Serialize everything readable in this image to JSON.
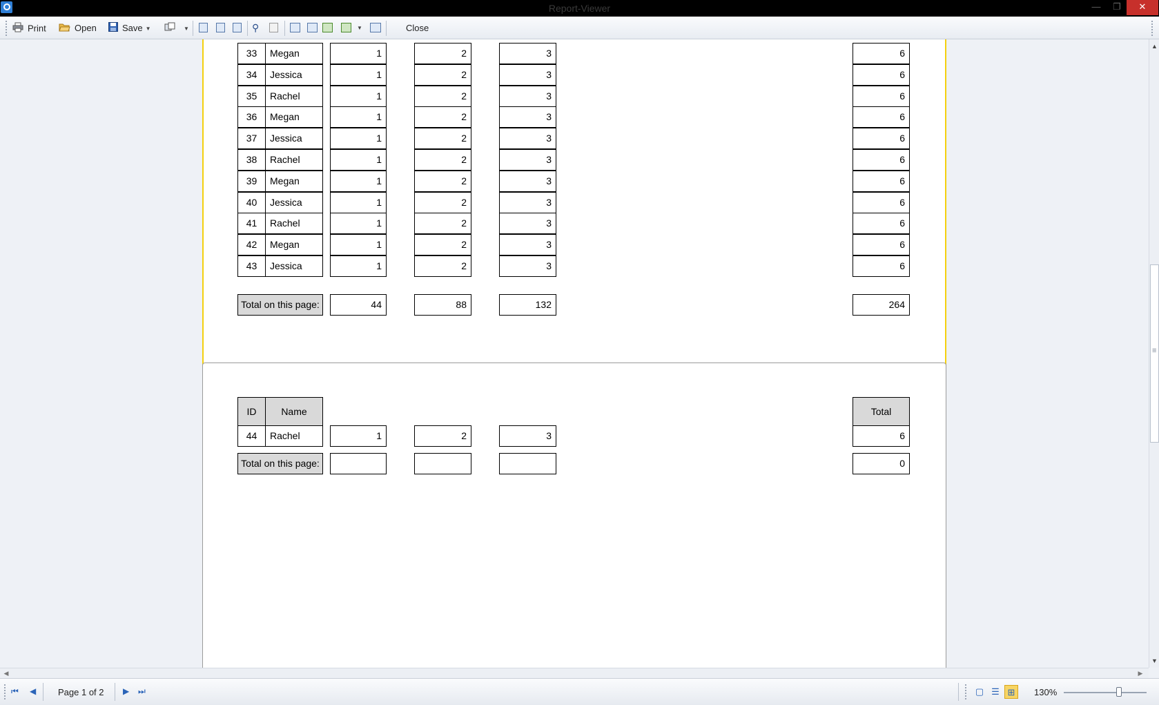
{
  "window": {
    "title": "Report-Viewer",
    "min": "—",
    "max": "❐",
    "close": "✕"
  },
  "toolbar": {
    "print_label": "Print",
    "open_label": "Open",
    "save_label": "Save",
    "close_label": "Close"
  },
  "report": {
    "page1_rows": [
      {
        "id": "33",
        "name": "Megan",
        "v1": "1",
        "v2": "2",
        "v3": "3",
        "total": "6"
      },
      {
        "id": "34",
        "name": "Jessica",
        "v1": "1",
        "v2": "2",
        "v3": "3",
        "total": "6"
      },
      {
        "id": "35",
        "name": "Rachel",
        "v1": "1",
        "v2": "2",
        "v3": "3",
        "total": "6"
      },
      {
        "id": "36",
        "name": "Megan",
        "v1": "1",
        "v2": "2",
        "v3": "3",
        "total": "6"
      },
      {
        "id": "37",
        "name": "Jessica",
        "v1": "1",
        "v2": "2",
        "v3": "3",
        "total": "6"
      },
      {
        "id": "38",
        "name": "Rachel",
        "v1": "1",
        "v2": "2",
        "v3": "3",
        "total": "6"
      },
      {
        "id": "39",
        "name": "Megan",
        "v1": "1",
        "v2": "2",
        "v3": "3",
        "total": "6"
      },
      {
        "id": "40",
        "name": "Jessica",
        "v1": "1",
        "v2": "2",
        "v3": "3",
        "total": "6"
      },
      {
        "id": "41",
        "name": "Rachel",
        "v1": "1",
        "v2": "2",
        "v3": "3",
        "total": "6"
      },
      {
        "id": "42",
        "name": "Megan",
        "v1": "1",
        "v2": "2",
        "v3": "3",
        "total": "6"
      },
      {
        "id": "43",
        "name": "Jessica",
        "v1": "1",
        "v2": "2",
        "v3": "3",
        "total": "6"
      }
    ],
    "page1_total": {
      "label": "Total on this page:",
      "v1": "44",
      "v2": "88",
      "v3": "132",
      "total": "264"
    },
    "header": {
      "id": "ID",
      "name": "Name",
      "total": "Total"
    },
    "page2_rows": [
      {
        "id": "44",
        "name": "Rachel",
        "v1": "1",
        "v2": "2",
        "v3": "3",
        "total": "6"
      }
    ],
    "page2_total": {
      "label": "Total on this page:",
      "v1": "",
      "v2": "",
      "v3": "",
      "total": "0"
    }
  },
  "status": {
    "page_indicator": "Page 1 of 2",
    "zoom": "130%"
  },
  "icons": [
    "print-icon",
    "open-folder-icon",
    "save-disk-icon",
    "export-icon",
    "find-icon",
    "first-page-icon",
    "prev-page-icon",
    "next-page-icon",
    "last-page-icon"
  ],
  "colors": {
    "selected_page_border": "#f4d00e",
    "cell_header_bg": "#d9d9d9",
    "close_button": "#c7302b"
  }
}
